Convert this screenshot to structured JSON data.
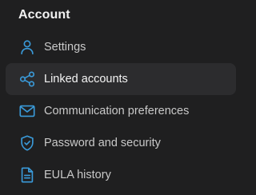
{
  "section": {
    "title": "Account"
  },
  "accent_color": "#3a9ad9",
  "active_background": "#2c2c2e",
  "nav": {
    "items": [
      {
        "label": "Settings",
        "icon": "person-icon",
        "active": false
      },
      {
        "label": "Linked accounts",
        "icon": "share-nodes-icon",
        "active": true
      },
      {
        "label": "Communication preferences",
        "icon": "envelope-icon",
        "active": false
      },
      {
        "label": "Password and security",
        "icon": "shield-check-icon",
        "active": false
      },
      {
        "label": "EULA history",
        "icon": "document-icon",
        "active": false
      }
    ]
  }
}
